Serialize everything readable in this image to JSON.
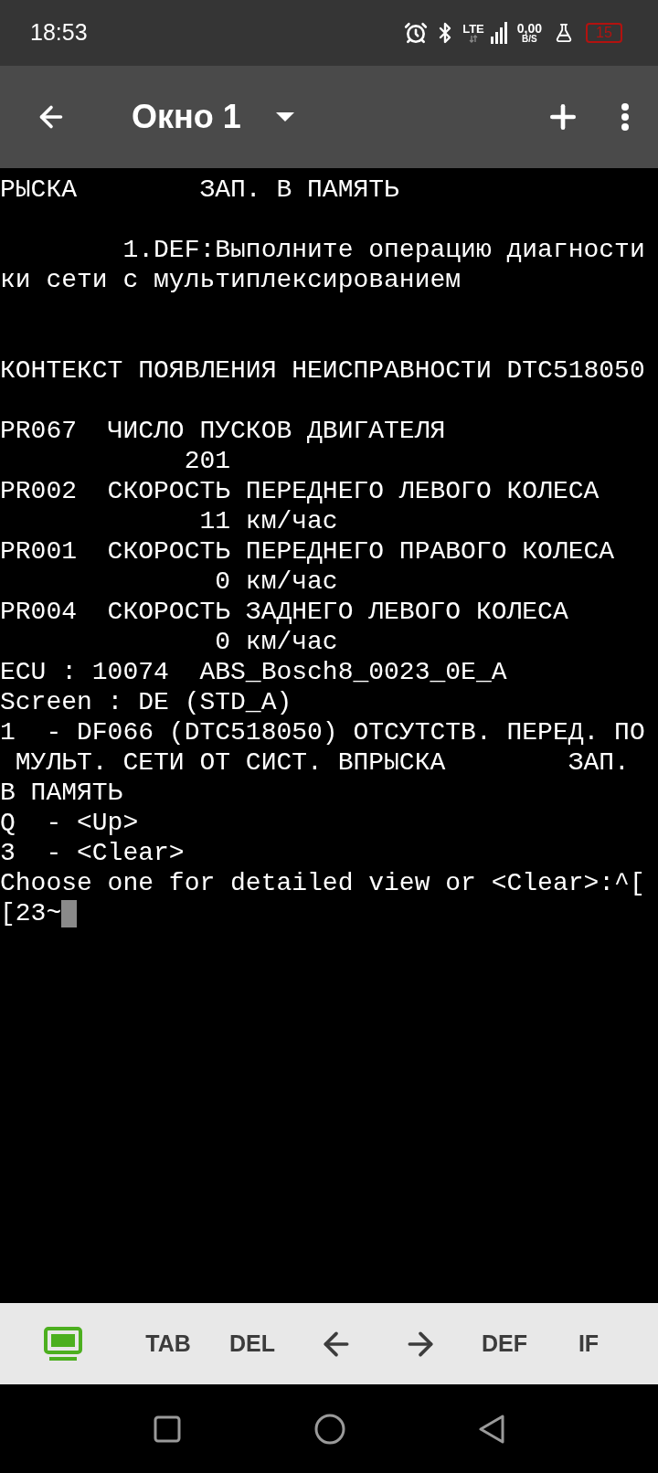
{
  "status_bar": {
    "time": "18:53",
    "network": "LTE",
    "speed": "0,00",
    "speed_unit": "B/S",
    "battery": "15"
  },
  "app_bar": {
    "title": "Окно 1"
  },
  "terminal": {
    "lines": [
      {
        "kind": "line",
        "text": "РЫСКА        ЗАП. В ПАМЯТЬ"
      },
      {
        "kind": "blank"
      },
      {
        "kind": "line",
        "text": "        1.DEF:Выполните операцию диагности"
      },
      {
        "kind": "line",
        "text": "ки сети с мультиплексированием"
      },
      {
        "kind": "blank"
      },
      {
        "kind": "blank"
      },
      {
        "kind": "line",
        "text": "КОНТЕКСТ ПОЯВЛЕНИЯ НЕИСПРАВНОСТИ DTC518050"
      },
      {
        "kind": "blank"
      },
      {
        "kind": "line",
        "text": "PR067  ЧИСЛО ПУСКОВ ДВИГАТЕЛЯ"
      },
      {
        "kind": "line",
        "text": "            201"
      },
      {
        "kind": "line",
        "text": "PR002  СКОРОСТЬ ПЕРЕДНЕГО ЛЕВОГО КОЛЕСА"
      },
      {
        "kind": "line",
        "text": "             11 км/час"
      },
      {
        "kind": "line",
        "text": "PR001  СКОРОСТЬ ПЕРЕДНЕГО ПРАВОГО КОЛЕСА"
      },
      {
        "kind": "line",
        "text": "              0 км/час"
      },
      {
        "kind": "line",
        "text": "PR004  СКОРОСТЬ ЗАДНЕГО ЛЕВОГО КОЛЕСА"
      },
      {
        "kind": "line",
        "text": "              0 км/час"
      },
      {
        "kind": "line",
        "text": "ECU : 10074  ABS_Bosch8_0023_0E_A"
      },
      {
        "kind": "line",
        "text": "Screen : DE (STD_A)"
      },
      {
        "kind": "line",
        "text": "1  - DF066 (DTC518050) ОТСУТСТВ. ПЕРЕД. ПО"
      },
      {
        "kind": "line",
        "text": " МУЛЬТ. СЕТИ ОТ СИСТ. ВПРЫСКА        ЗАП."
      },
      {
        "kind": "line",
        "text": "В ПАМЯТЬ"
      },
      {
        "kind": "line",
        "text": "Q  - <Up>"
      },
      {
        "kind": "line",
        "text": "3  - <Clear>"
      },
      {
        "kind": "line",
        "text": "Choose one for detailed view or <Clear>:^["
      },
      {
        "kind": "prompt",
        "text": "[23~"
      }
    ]
  },
  "key_bar": [
    {
      "kind": "keyboard"
    },
    {
      "kind": "text",
      "label": "TAB"
    },
    {
      "kind": "text",
      "label": "DEL"
    },
    {
      "kind": "left"
    },
    {
      "kind": "right"
    },
    {
      "kind": "text",
      "label": "DEF"
    },
    {
      "kind": "text",
      "label": "IF"
    }
  ]
}
